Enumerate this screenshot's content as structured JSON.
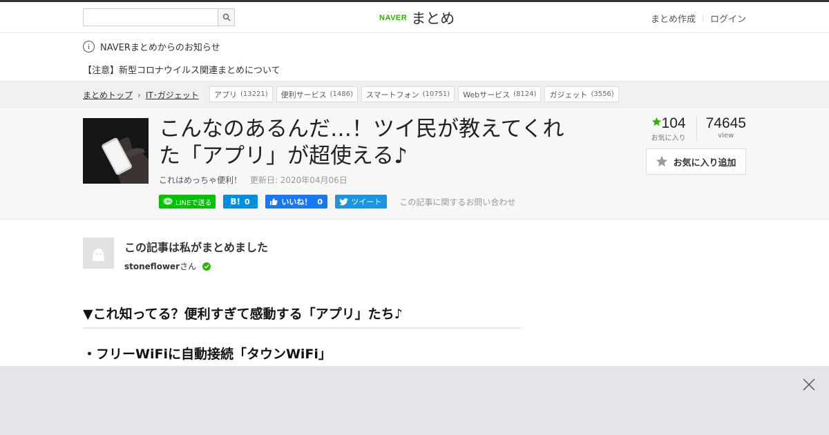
{
  "header": {
    "search_placeholder": "",
    "logo_brand": "NAVER",
    "logo_name": "まとめ",
    "links": [
      "まとめ作成",
      "ログイン"
    ]
  },
  "notice": {
    "title": "NAVERまとめからのお知らせ",
    "message": "【注意】新型コロナウイルス関連まとめについて"
  },
  "breadcrumb": {
    "items": [
      "まとめトップ",
      "IT･ガジェット"
    ]
  },
  "tags": [
    {
      "label": "アプリ",
      "count": "(13221)"
    },
    {
      "label": "便利サービス",
      "count": "(1486)"
    },
    {
      "label": "スマートフォン",
      "count": "(10751)"
    },
    {
      "label": "Webサービス",
      "count": "(8124)"
    },
    {
      "label": "ガジェット",
      "count": "(3556)"
    }
  ],
  "article": {
    "title": "こんなのあるんだ…！ツイ民が教えてくれた「アプリ」が超使える♪",
    "subtitle": "これはめっちゃ便利！",
    "updated": "更新日: 2020年04月06日",
    "inquiry": "この記事に関するお問い合わせ",
    "share": {
      "line": "LINEで送る",
      "hatena_count": "0",
      "fb_label": "いいね！",
      "fb_count": "0",
      "tweet": "ツイート"
    },
    "favorites": "104",
    "favorites_label": "お気に入り",
    "views": "74645",
    "views_label": "view",
    "fav_button": "お気に入り追加"
  },
  "author": {
    "heading": "この記事は私がまとめました",
    "name": "stoneflower",
    "suffix": "さん"
  },
  "sections": [
    "▼これ知ってる？便利すぎて感動する「アプリ」たち♪",
    "・フリーWiFiに自動接続「タウンWiFi」"
  ],
  "colors": {
    "brand_green": "#2db400",
    "line_green": "#00c300",
    "facebook_blue": "#1877f2",
    "twitter_blue": "#1b95e0",
    "hatena_blue": "#008fde"
  }
}
